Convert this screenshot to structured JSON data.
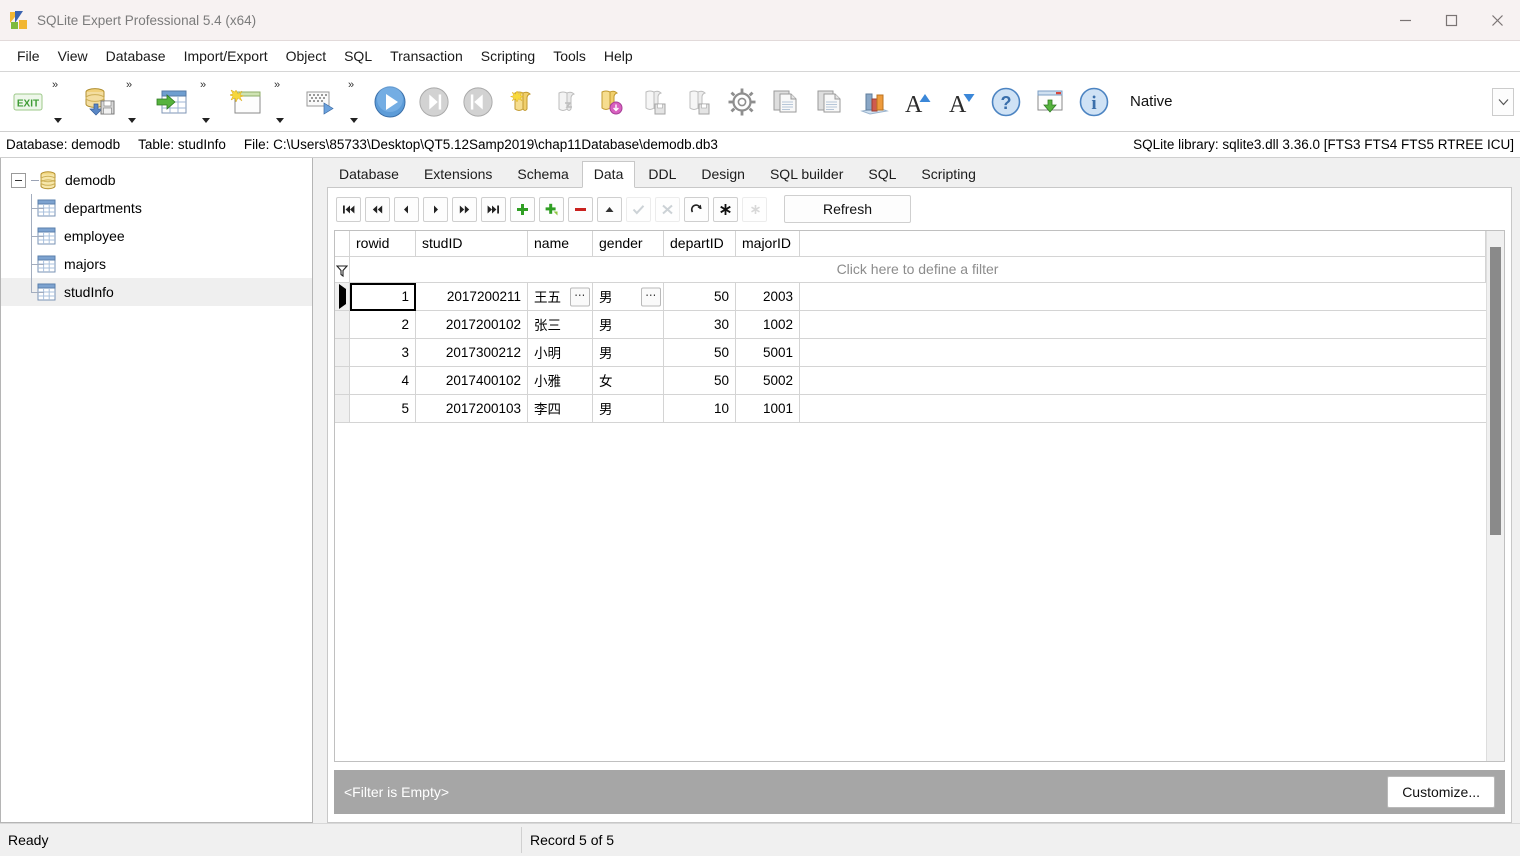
{
  "window": {
    "title": "SQLite Expert Professional 5.4 (x64)",
    "app_icon": "sqlite-expert-logo-icon",
    "controls": [
      {
        "name": "minimize-button",
        "icon": "minimize-icon"
      },
      {
        "name": "maximize-button",
        "icon": "maximize-icon"
      },
      {
        "name": "close-button",
        "icon": "close-icon"
      }
    ]
  },
  "menubar": {
    "items": [
      "File",
      "View",
      "Database",
      "Import/Export",
      "Object",
      "SQL",
      "Transaction",
      "Scripting",
      "Tools",
      "Help"
    ]
  },
  "toolbar": {
    "native_label": "Native",
    "overflow_icon": "chevron-down-icon",
    "groups": [
      {
        "buttons": [
          {
            "name": "exit-button",
            "icon": "exit-icon"
          }
        ],
        "has_dropdown": true
      },
      {
        "buttons": [
          {
            "name": "backup-database-button",
            "icon": "database-save-icon"
          }
        ],
        "has_dropdown": true
      },
      {
        "buttons": [
          {
            "name": "import-data-button",
            "icon": "import-table-icon"
          }
        ],
        "has_dropdown": true
      },
      {
        "buttons": [
          {
            "name": "new-window-button",
            "icon": "new-window-icon"
          }
        ],
        "has_dropdown": true
      },
      {
        "buttons": [
          {
            "name": "design-grid-button",
            "icon": "grid-run-icon"
          }
        ],
        "has_dropdown": true
      }
    ],
    "plain_buttons": [
      {
        "name": "execute-button",
        "icon": "play-blue-icon",
        "enabled": true
      },
      {
        "name": "execute-step-button",
        "icon": "play-next-grey-icon",
        "enabled": false
      },
      {
        "name": "execute-first-button",
        "icon": "play-prev-grey-icon",
        "enabled": false
      },
      {
        "name": "new-sql-button",
        "icon": "scroll-new-icon",
        "enabled": true
      },
      {
        "name": "run-sql-button",
        "icon": "scroll-run-grey-icon",
        "enabled": false
      },
      {
        "name": "sql-download-button",
        "icon": "scroll-magenta-icon",
        "enabled": true
      },
      {
        "name": "save-sql-button",
        "icon": "scroll-save-grey-icon",
        "enabled": false
      },
      {
        "name": "save-sql-as-button",
        "icon": "scroll-save2-grey-icon",
        "enabled": false
      },
      {
        "name": "options-button",
        "icon": "gear-icon",
        "enabled": true
      },
      {
        "name": "copy-button",
        "icon": "copy-pages-icon",
        "enabled": true
      },
      {
        "name": "paste-button",
        "icon": "copy-pages2-icon",
        "enabled": true
      },
      {
        "name": "statistics-button",
        "icon": "bar-chart-icon",
        "enabled": true
      },
      {
        "name": "increase-font-button",
        "icon": "font-increase-icon",
        "enabled": true
      },
      {
        "name": "decrease-font-button",
        "icon": "font-decrease-icon",
        "enabled": true
      },
      {
        "name": "help-button",
        "icon": "question-circle-icon",
        "enabled": true
      },
      {
        "name": "install-window-button",
        "icon": "window-download-icon",
        "enabled": true
      },
      {
        "name": "about-button",
        "icon": "info-circle-icon",
        "enabled": true
      }
    ]
  },
  "infobar": {
    "database_label": "Database: demodb",
    "table_label": "Table: studInfo",
    "file_label": "File: C:\\Users\\85733\\Desktop\\QT5.12Samp2019\\chap11Database\\demodb.db3",
    "library_label": "SQLite library: sqlite3.dll 3.36.0 [FTS3 FTS4 FTS5 RTREE ICU]"
  },
  "sidebar": {
    "root": {
      "label": "demodb",
      "icon": "database-cylinder-icon",
      "expanded": true
    },
    "tables": [
      {
        "label": "departments",
        "icon": "table-icon",
        "selected": false
      },
      {
        "label": "employee",
        "icon": "table-icon",
        "selected": false
      },
      {
        "label": "majors",
        "icon": "table-icon",
        "selected": false
      },
      {
        "label": "studInfo",
        "icon": "table-icon",
        "selected": true
      }
    ]
  },
  "tabs": {
    "items": [
      {
        "label": "Database",
        "active": false
      },
      {
        "label": "Extensions",
        "active": false
      },
      {
        "label": "Schema",
        "active": false
      },
      {
        "label": "Data",
        "active": true
      },
      {
        "label": "DDL",
        "active": false
      },
      {
        "label": "Design",
        "active": false
      },
      {
        "label": "SQL builder",
        "active": false
      },
      {
        "label": "SQL",
        "active": false
      },
      {
        "label": "Scripting",
        "active": false
      }
    ]
  },
  "data_nav": {
    "buttons": [
      {
        "name": "first-record-button",
        "icon": "skip-first-icon",
        "enabled": true
      },
      {
        "name": "prior-page-button",
        "icon": "rewind-icon",
        "enabled": true
      },
      {
        "name": "prior-record-button",
        "icon": "prev-icon",
        "enabled": true
      },
      {
        "name": "next-record-button",
        "icon": "next-icon",
        "enabled": true
      },
      {
        "name": "next-page-button",
        "icon": "fast-forward-icon",
        "enabled": true
      },
      {
        "name": "last-record-button",
        "icon": "skip-last-icon",
        "enabled": true
      },
      {
        "name": "insert-record-button",
        "icon": "plus-green-icon",
        "enabled": true
      },
      {
        "name": "duplicate-record-button",
        "icon": "plus-copy-green-icon",
        "enabled": true
      },
      {
        "name": "delete-record-button",
        "icon": "minus-red-icon",
        "enabled": true
      },
      {
        "name": "edit-record-button",
        "icon": "triangle-up-icon",
        "enabled": true
      },
      {
        "name": "post-edit-button",
        "icon": "check-icon",
        "enabled": false
      },
      {
        "name": "cancel-edit-button",
        "icon": "cancel-x-icon",
        "enabled": false
      },
      {
        "name": "refresh-record-button",
        "icon": "redo-arrow-icon",
        "enabled": true
      },
      {
        "name": "set-null-button",
        "icon": "asterisk-icon",
        "enabled": true
      },
      {
        "name": "clear-null-button",
        "icon": "asterisk-grey-icon",
        "enabled": false
      }
    ],
    "refresh_label": "Refresh"
  },
  "grid": {
    "filter_row_placeholder": "Click here to define a filter",
    "filter_icon": "funnel-icon",
    "columns": [
      "rowid",
      "studID",
      "name",
      "gender",
      "departID",
      "majorID"
    ],
    "rows": [
      {
        "rowid": "1",
        "studID": "2017200211",
        "name": "王五",
        "gender": "男",
        "departID": "50",
        "majorID": "2003",
        "current": true
      },
      {
        "rowid": "2",
        "studID": "2017200102",
        "name": "张三",
        "gender": "男",
        "departID": "30",
        "majorID": "1002",
        "current": false
      },
      {
        "rowid": "3",
        "studID": "2017300212",
        "name": "小明",
        "gender": "男",
        "departID": "50",
        "majorID": "5001",
        "current": false
      },
      {
        "rowid": "4",
        "studID": "2017400102",
        "name": "小雅",
        "gender": "女",
        "departID": "50",
        "majorID": "5002",
        "current": false
      },
      {
        "rowid": "5",
        "studID": "2017200103",
        "name": "李四",
        "gender": "男",
        "departID": "10",
        "majorID": "1001",
        "current": false
      }
    ],
    "ellipsis_button_label": "⋯"
  },
  "filterbar": {
    "text": "<Filter is Empty>",
    "customize_label": "Customize..."
  },
  "statusbar": {
    "state": "Ready",
    "record_info": "Record 5 of 5"
  },
  "colors": {
    "titlebar_bg": "#f7f2f2",
    "accent_blue": "#3a7ebf",
    "filterbar_bg": "#a6a6a6",
    "selection_bg": "#efefef",
    "green": "#37a32a",
    "red": "#cc2222"
  }
}
